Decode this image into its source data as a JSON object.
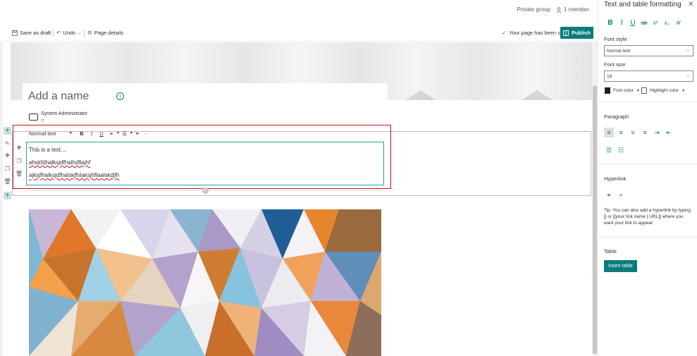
{
  "header": {
    "group_privacy": "Private group",
    "member_count": "1 member"
  },
  "command_bar": {
    "save_draft": "Save as draft",
    "undo": "Undo",
    "page_details": "Page details",
    "saved_status": "Your page has been saved",
    "publish": "Publish"
  },
  "page": {
    "title_placeholder": "Add a name",
    "author_name": "System Administrator",
    "author_dept": "IT"
  },
  "rte": {
    "style_value": "Normal text",
    "lines": [
      "This is a test....",
      "ahskfdhalksjdfhalhdflajhf",
      "ajksjfhalksjdfhalskjfhlaksjhflaalskdjfh"
    ]
  },
  "pane": {
    "title": "Text and table formatting",
    "font_style_label": "Font style",
    "font_style_value": "Normal text",
    "font_size_label": "Font size",
    "font_size_value": "18",
    "font_color_label": "Font color",
    "highlight_color_label": "Highlight color",
    "paragraph_label": "Paragraph",
    "hyperlink_label": "Hyperlink",
    "tip": "Tip: You can also add a hyperlink by typing [[ or [[your link name | URL]] where you want your link to appear.",
    "table_label": "Table",
    "insert_table": "Insert table"
  },
  "colors": {
    "accent": "#0b7c7c",
    "selection_border": "#c50f1f",
    "editor_border": "#2aa0a4"
  }
}
